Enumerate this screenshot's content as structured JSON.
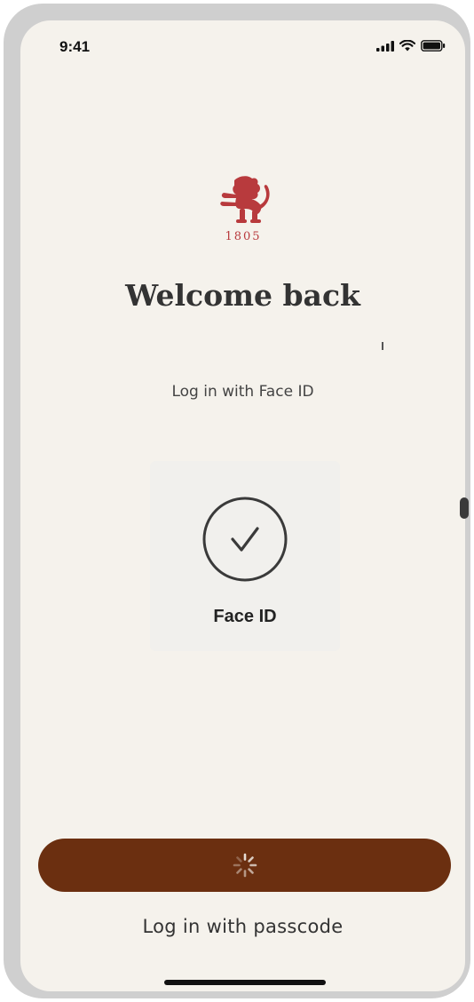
{
  "status_bar": {
    "time": "9:41",
    "icons": [
      "signal-icon",
      "wifi-icon",
      "battery-icon"
    ]
  },
  "logo": {
    "year": "1805",
    "icon": "lion-crest-icon",
    "color": "#b83a3d"
  },
  "welcome": {
    "title": "Welcome back",
    "subtitle": "Log in with Face ID"
  },
  "face_id": {
    "icon": "check-circle-icon",
    "label": "Face ID"
  },
  "actions": {
    "primary_button_color": "#6b2f10",
    "primary_button_state": "loading",
    "passcode_link": "Log in with passcode"
  },
  "colors": {
    "background": "#f5f2ec",
    "card": "#f1f0ed",
    "accent": "#6b2f10"
  }
}
